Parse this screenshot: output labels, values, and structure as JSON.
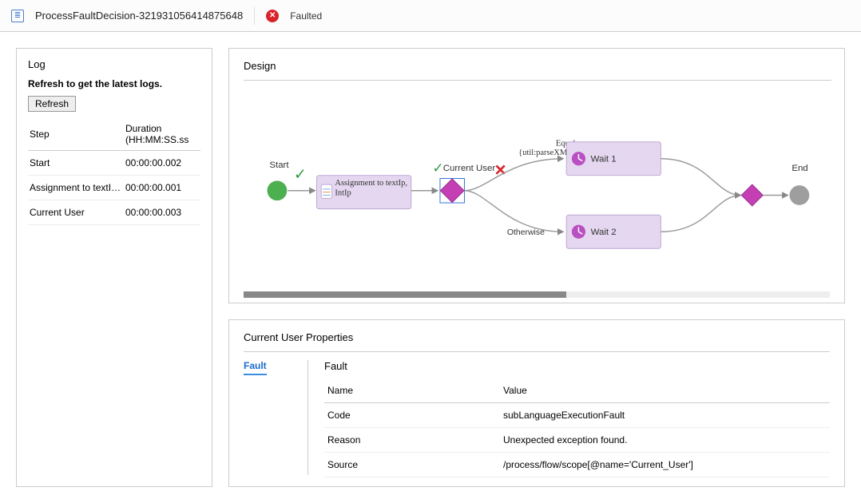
{
  "header": {
    "title": "ProcessFaultDecision-321931056414875648",
    "status_label": "Faulted"
  },
  "log": {
    "title": "Log",
    "refresh_msg": "Refresh to get the latest logs.",
    "refresh_label": "Refresh",
    "col_step": "Step",
    "col_dur": "Duration (HH:MM:SS.ss",
    "rows": [
      {
        "step": "Start",
        "dur": "00:00:00.002"
      },
      {
        "step": "Assignment to textIp, In...",
        "dur": "00:00:00.001"
      },
      {
        "step": "Current User",
        "dur": "00:00:00.003"
      }
    ]
  },
  "design": {
    "title": "Design",
    "nodes": {
      "start": "Start",
      "assign": "Assignment to textIp, IntIp",
      "current_user": "Current User",
      "equals": "Equals {util:parseXML...",
      "otherwise": "Otherwise",
      "wait1": "Wait 1",
      "wait2": "Wait 2",
      "end": "End"
    }
  },
  "properties": {
    "title": "Current User Properties",
    "tab_fault": "Fault",
    "fault_section": "Fault",
    "col_name": "Name",
    "col_value": "Value",
    "rows": [
      {
        "name": "Code",
        "value": "subLanguageExecutionFault"
      },
      {
        "name": "Reason",
        "value": "Unexpected exception found."
      },
      {
        "name": "Source",
        "value": "/process/flow/scope[@name='Current_User']"
      }
    ]
  }
}
